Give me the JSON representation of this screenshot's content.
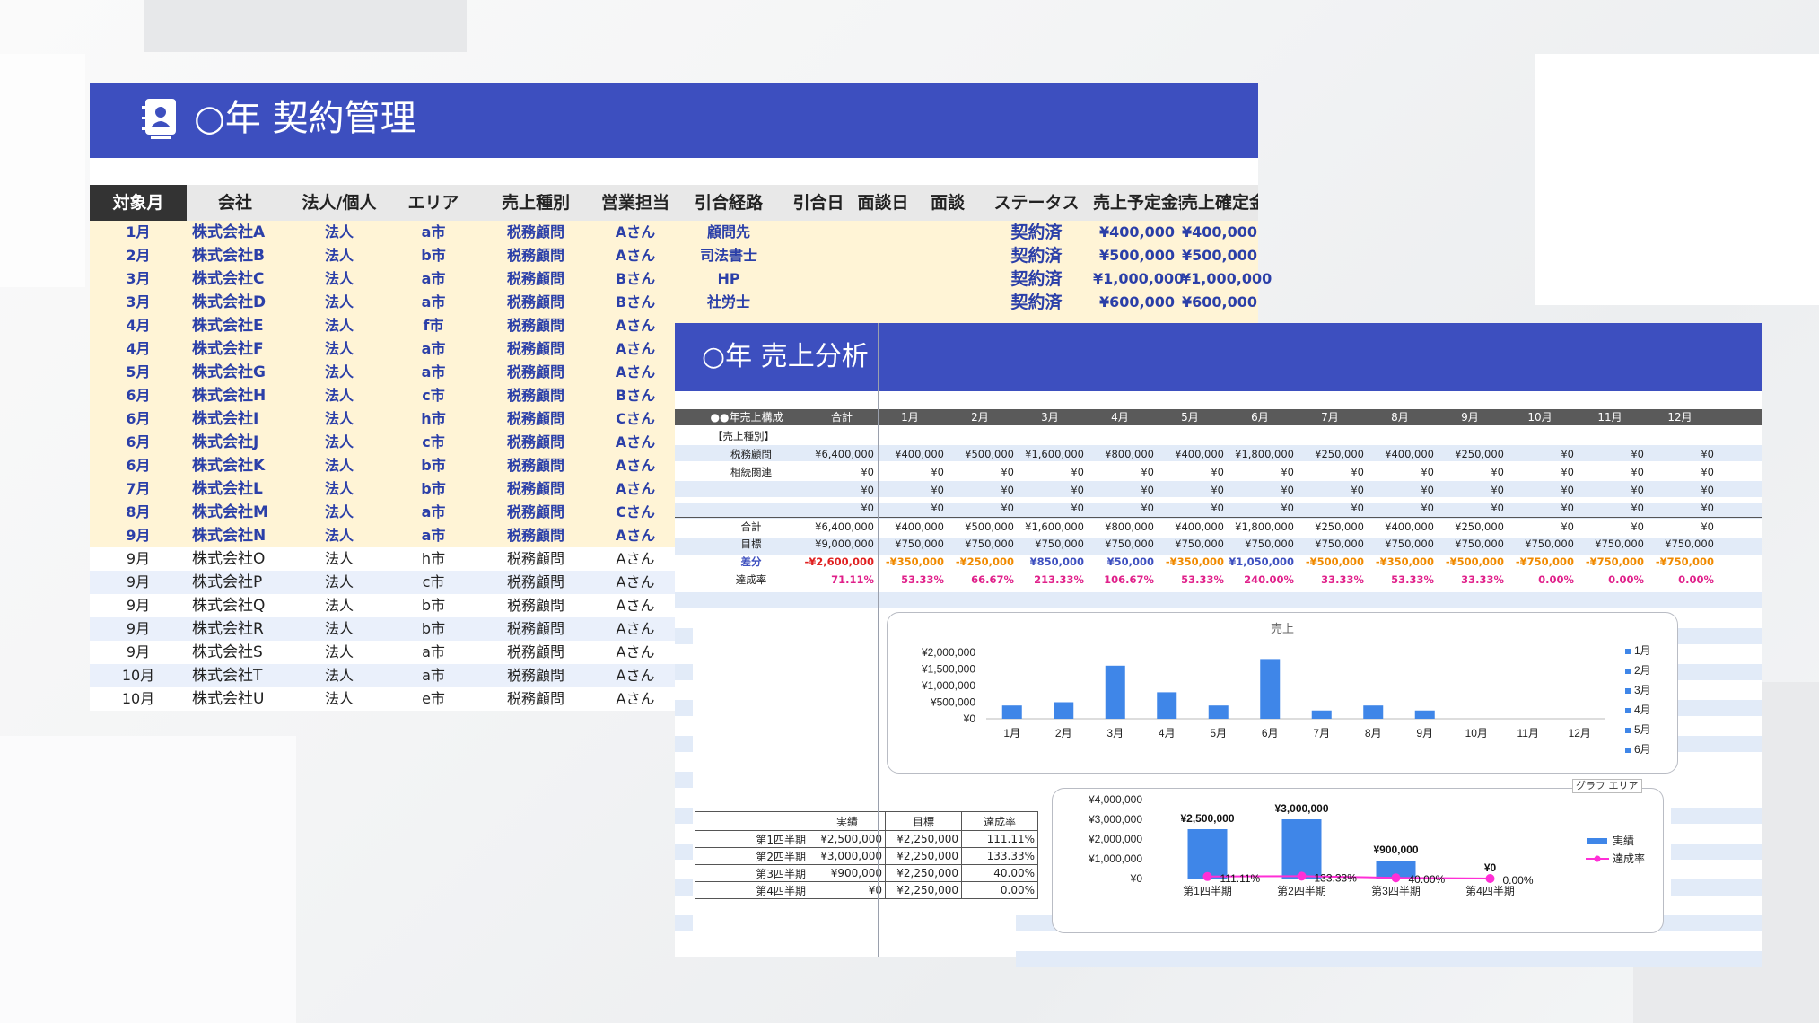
{
  "sheet1": {
    "title": "○年 契約管理",
    "columns": [
      "対象月",
      "会社",
      "法人/個人",
      "エリア",
      "売上種別",
      "営業担当",
      "引合経路",
      "引合日",
      "面談日",
      "面談",
      "ステータス",
      "売上予定金額",
      "売上確定金額"
    ],
    "rows": [
      {
        "month": "1月",
        "company": "株式会社A",
        "type": "法人",
        "area": "a市",
        "kind": "税務顧問",
        "rep": "Aさん",
        "route": "顧問先",
        "status": "契約済",
        "planned": "¥400,000",
        "confirmed": "¥400,000"
      },
      {
        "month": "2月",
        "company": "株式会社B",
        "type": "法人",
        "area": "b市",
        "kind": "税務顧問",
        "rep": "Aさん",
        "route": "司法書士",
        "status": "契約済",
        "planned": "¥500,000",
        "confirmed": "¥500,000"
      },
      {
        "month": "3月",
        "company": "株式会社C",
        "type": "法人",
        "area": "a市",
        "kind": "税務顧問",
        "rep": "Bさん",
        "route": "HP",
        "status": "契約済",
        "planned": "¥1,000,000",
        "confirmed": "¥1,000,000"
      },
      {
        "month": "3月",
        "company": "株式会社D",
        "type": "法人",
        "area": "a市",
        "kind": "税務顧問",
        "rep": "Bさん",
        "route": "社労士",
        "status": "契約済",
        "planned": "¥600,000",
        "confirmed": "¥600,000"
      },
      {
        "month": "4月",
        "company": "株式会社E",
        "type": "法人",
        "area": "f市",
        "kind": "税務顧問",
        "rep": "Aさん",
        "route": "",
        "status": "",
        "planned": "",
        "confirmed": ""
      },
      {
        "month": "4月",
        "company": "株式会社F",
        "type": "法人",
        "area": "a市",
        "kind": "税務顧問",
        "rep": "Aさん",
        "route": "",
        "status": "",
        "planned": "",
        "confirmed": ""
      },
      {
        "month": "5月",
        "company": "株式会社G",
        "type": "法人",
        "area": "a市",
        "kind": "税務顧問",
        "rep": "Aさん",
        "route": "",
        "status": "",
        "planned": "",
        "confirmed": ""
      },
      {
        "month": "6月",
        "company": "株式会社H",
        "type": "法人",
        "area": "c市",
        "kind": "税務顧問",
        "rep": "Bさん",
        "route": "",
        "status": "",
        "planned": "",
        "confirmed": ""
      },
      {
        "month": "6月",
        "company": "株式会社I",
        "type": "法人",
        "area": "h市",
        "kind": "税務顧問",
        "rep": "Cさん",
        "route": "",
        "status": "",
        "planned": "",
        "confirmed": ""
      },
      {
        "month": "6月",
        "company": "株式会社J",
        "type": "法人",
        "area": "c市",
        "kind": "税務顧問",
        "rep": "Aさん",
        "route": "",
        "status": "",
        "planned": "",
        "confirmed": ""
      },
      {
        "month": "6月",
        "company": "株式会社K",
        "type": "法人",
        "area": "b市",
        "kind": "税務顧問",
        "rep": "Aさん",
        "route": "",
        "status": "",
        "planned": "",
        "confirmed": ""
      },
      {
        "month": "7月",
        "company": "株式会社L",
        "type": "法人",
        "area": "b市",
        "kind": "税務顧問",
        "rep": "Aさん",
        "route": "",
        "status": "",
        "planned": "",
        "confirmed": ""
      },
      {
        "month": "8月",
        "company": "株式会社M",
        "type": "法人",
        "area": "a市",
        "kind": "税務顧問",
        "rep": "Cさん",
        "route": "",
        "status": "",
        "planned": "",
        "confirmed": ""
      },
      {
        "month": "9月",
        "company": "株式会社N",
        "type": "法人",
        "area": "a市",
        "kind": "税務顧問",
        "rep": "Aさん",
        "route": "",
        "status": "",
        "planned": "",
        "confirmed": ""
      },
      {
        "month": "9月",
        "company": "株式会社O",
        "type": "法人",
        "area": "h市",
        "kind": "税務顧問",
        "rep": "Aさん",
        "route": "",
        "status": "",
        "planned": "",
        "confirmed": ""
      },
      {
        "month": "9月",
        "company": "株式会社P",
        "type": "法人",
        "area": "c市",
        "kind": "税務顧問",
        "rep": "Aさん",
        "route": "",
        "status": "",
        "planned": "",
        "confirmed": ""
      },
      {
        "month": "9月",
        "company": "株式会社Q",
        "type": "法人",
        "area": "b市",
        "kind": "税務顧問",
        "rep": "Aさん",
        "route": "",
        "status": "",
        "planned": "",
        "confirmed": ""
      },
      {
        "month": "9月",
        "company": "株式会社R",
        "type": "法人",
        "area": "b市",
        "kind": "税務顧問",
        "rep": "Aさん",
        "route": "",
        "status": "",
        "planned": "",
        "confirmed": ""
      },
      {
        "month": "9月",
        "company": "株式会社S",
        "type": "法人",
        "area": "a市",
        "kind": "税務顧問",
        "rep": "Aさん",
        "route": "",
        "status": "",
        "planned": "",
        "confirmed": ""
      },
      {
        "month": "10月",
        "company": "株式会社T",
        "type": "法人",
        "area": "a市",
        "kind": "税務顧問",
        "rep": "Aさん",
        "route": "",
        "status": "",
        "planned": "",
        "confirmed": ""
      },
      {
        "month": "10月",
        "company": "株式会社U",
        "type": "法人",
        "area": "e市",
        "kind": "税務顧問",
        "rep": "Aさん",
        "route": "",
        "status": "",
        "planned": "",
        "confirmed": ""
      }
    ],
    "highlight_count": 14,
    "colors": {
      "header": "#3d4fbf",
      "highlight": "#fff4d6",
      "text_blue": "#2b3fa8"
    }
  },
  "sheet2": {
    "title": "○年 売上分析",
    "header_cols": [
      "●●年売上構成",
      "合計",
      "1月",
      "2月",
      "3月",
      "4月",
      "5月",
      "6月",
      "7月",
      "8月",
      "9月",
      "10月",
      "11月",
      "12月"
    ],
    "section_label": "【売上種別】",
    "rows": [
      {
        "label": "税務顧問",
        "values": [
          "¥6,400,000",
          "¥400,000",
          "¥500,000",
          "¥1,600,000",
          "¥800,000",
          "¥400,000",
          "¥1,800,000",
          "¥250,000",
          "¥400,000",
          "¥250,000",
          "¥0",
          "¥0",
          "¥0"
        ]
      },
      {
        "label": "相続関連",
        "values": [
          "¥0",
          "¥0",
          "¥0",
          "¥0",
          "¥0",
          "¥0",
          "¥0",
          "¥0",
          "¥0",
          "¥0",
          "¥0",
          "¥0",
          "¥0"
        ]
      },
      {
        "label": "",
        "values": [
          "¥0",
          "¥0",
          "¥0",
          "¥0",
          "¥0",
          "¥0",
          "¥0",
          "¥0",
          "¥0",
          "¥0",
          "¥0",
          "¥0",
          "¥0"
        ]
      },
      {
        "label": "",
        "values": [
          "¥0",
          "¥0",
          "¥0",
          "¥0",
          "¥0",
          "¥0",
          "¥0",
          "¥0",
          "¥0",
          "¥0",
          "¥0",
          "¥0",
          "¥0"
        ]
      }
    ],
    "total": {
      "label": "合計",
      "values": [
        "¥6,400,000",
        "¥400,000",
        "¥500,000",
        "¥1,600,000",
        "¥800,000",
        "¥400,000",
        "¥1,800,000",
        "¥250,000",
        "¥400,000",
        "¥250,000",
        "¥0",
        "¥0",
        "¥0"
      ]
    },
    "target": {
      "label": "目標",
      "values": [
        "¥9,000,000",
        "¥750,000",
        "¥750,000",
        "¥750,000",
        "¥750,000",
        "¥750,000",
        "¥750,000",
        "¥750,000",
        "¥750,000",
        "¥750,000",
        "¥750,000",
        "¥750,000",
        "¥750,000"
      ]
    },
    "diff": {
      "label": "差分",
      "values": [
        "-¥2,600,000",
        "-¥350,000",
        "-¥250,000",
        "¥850,000",
        "¥50,000",
        "-¥350,000",
        "¥1,050,000",
        "-¥500,000",
        "-¥350,000",
        "-¥500,000",
        "-¥750,000",
        "-¥750,000",
        "-¥750,000"
      ]
    },
    "rate": {
      "label": "達成率",
      "values": [
        "71.11%",
        "53.33%",
        "66.67%",
        "213.33%",
        "106.67%",
        "53.33%",
        "240.00%",
        "33.33%",
        "53.33%",
        "33.33%",
        "0.00%",
        "0.00%",
        "0.00%"
      ]
    },
    "quarter_table": {
      "headers": [
        "",
        "実績",
        "目標",
        "達成率"
      ],
      "rows": [
        [
          "第1四半期",
          "¥2,500,000",
          "¥2,250,000",
          "111.11%"
        ],
        [
          "第2四半期",
          "¥3,000,000",
          "¥2,250,000",
          "133.33%"
        ],
        [
          "第3四半期",
          "¥900,000",
          "¥2,250,000",
          "40.00%"
        ],
        [
          "第4四半期",
          "¥0",
          "¥2,250,000",
          "0.00%"
        ]
      ]
    },
    "chart2_tag": "グラフ エリア"
  },
  "chart_data": [
    {
      "type": "bar",
      "title": "売上",
      "categories": [
        "1月",
        "2月",
        "3月",
        "4月",
        "5月",
        "6月",
        "7月",
        "8月",
        "9月",
        "10月",
        "11月",
        "12月"
      ],
      "values": [
        400000,
        500000,
        1600000,
        800000,
        400000,
        1800000,
        250000,
        400000,
        250000,
        0,
        0,
        0
      ],
      "ylim": [
        0,
        2000000
      ],
      "yticks": [
        "¥2,000,000",
        "¥1,500,000",
        "¥1,000,000",
        "¥500,000",
        "¥0"
      ],
      "legend": [
        "1月",
        "2月",
        "3月",
        "4月",
        "5月",
        "6月"
      ],
      "legend_position": "right",
      "color": "#3f86e8"
    },
    {
      "type": "bar",
      "categories": [
        "第1四半期",
        "第2四半期",
        "第3四半期",
        "第4四半期"
      ],
      "series": [
        {
          "name": "実績",
          "values": [
            2500000,
            3000000,
            900000,
            0
          ],
          "labels": [
            "¥2,500,000",
            "¥3,000,000",
            "¥900,000",
            "¥0"
          ],
          "color": "#3f86e8"
        },
        {
          "name": "達成率",
          "values": [
            111.11,
            133.33,
            40.0,
            0.0
          ],
          "labels": [
            "111.11%",
            "133.33%",
            "40.00%",
            "0.00%"
          ],
          "color": "#ff2fd6",
          "kind": "line"
        }
      ],
      "ylim": [
        0,
        4000000
      ],
      "yticks": [
        "¥4,000,000",
        "¥3,000,000",
        "¥2,000,000",
        "¥1,000,000",
        "¥0"
      ],
      "legend_position": "right"
    }
  ]
}
